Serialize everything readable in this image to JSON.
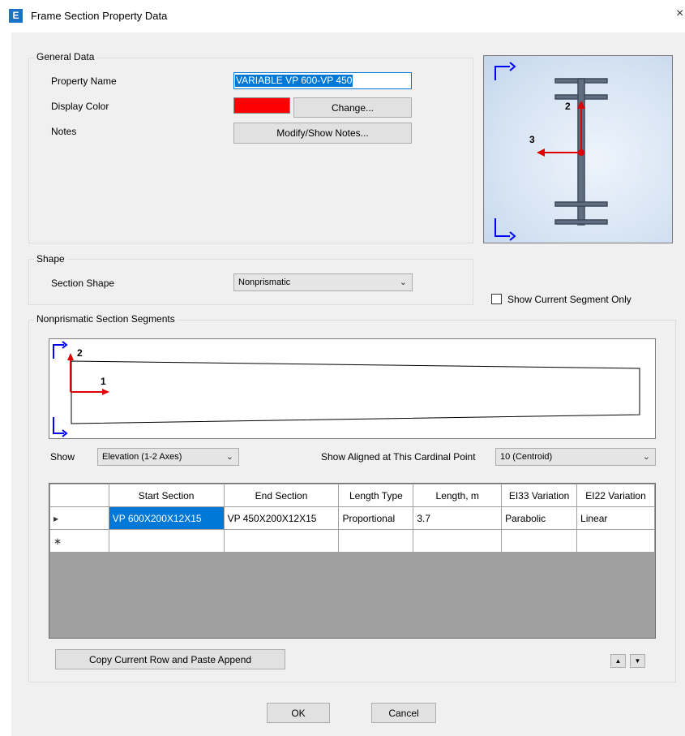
{
  "window": {
    "title": "Frame Section Property Data",
    "icon_letter": "E",
    "close_glyph": "×"
  },
  "general": {
    "title": "General Data",
    "property_name_label": "Property Name",
    "property_name_value": "VARIABLE VP 600-VP 450",
    "display_color_label": "Display Color",
    "display_color": "#ff0000",
    "change_button": "Change...",
    "notes_label": "Notes",
    "notes_button": "Modify/Show Notes..."
  },
  "preview": {
    "axis2": "2",
    "axis3": "3"
  },
  "shape": {
    "title": "Shape",
    "section_shape_label": "Section Shape",
    "section_shape_value": "Nonprismatic"
  },
  "show_current_segment_only": {
    "label": "Show Current Segment Only",
    "checked": false
  },
  "segments": {
    "title": "Nonprismatic Section Segments",
    "elev_axis2": "2",
    "elev_axis1": "1",
    "show_label": "Show",
    "show_value": "Elevation (1-2 Axes)",
    "cardinal_label": "Show Aligned at This Cardinal Point",
    "cardinal_value": "10 (Centroid)",
    "columns": [
      "Start Section",
      "End Section",
      "Length Type",
      "Length, m",
      "EI33 Variation",
      "EI22 Variation"
    ],
    "rows": [
      {
        "marker": "▸",
        "cells": [
          "VP 600X200X12X15",
          "VP 450X200X12X15",
          "Proportional",
          "3.7",
          "Parabolic",
          "Linear"
        ]
      },
      {
        "marker": "∗",
        "cells": [
          "",
          "",
          "",
          "",
          "",
          ""
        ]
      }
    ],
    "copy_button": "Copy Current Row and Paste Append",
    "move_up_icon": "up-arrow-icon",
    "move_down_icon": "down-arrow-icon"
  },
  "buttons": {
    "ok": "OK",
    "cancel": "Cancel"
  },
  "colors": {
    "accent": "#0078d7",
    "axis_red": "#e00000",
    "axis_blue": "#0000ff",
    "preview_bg": "#d6e4f3"
  }
}
